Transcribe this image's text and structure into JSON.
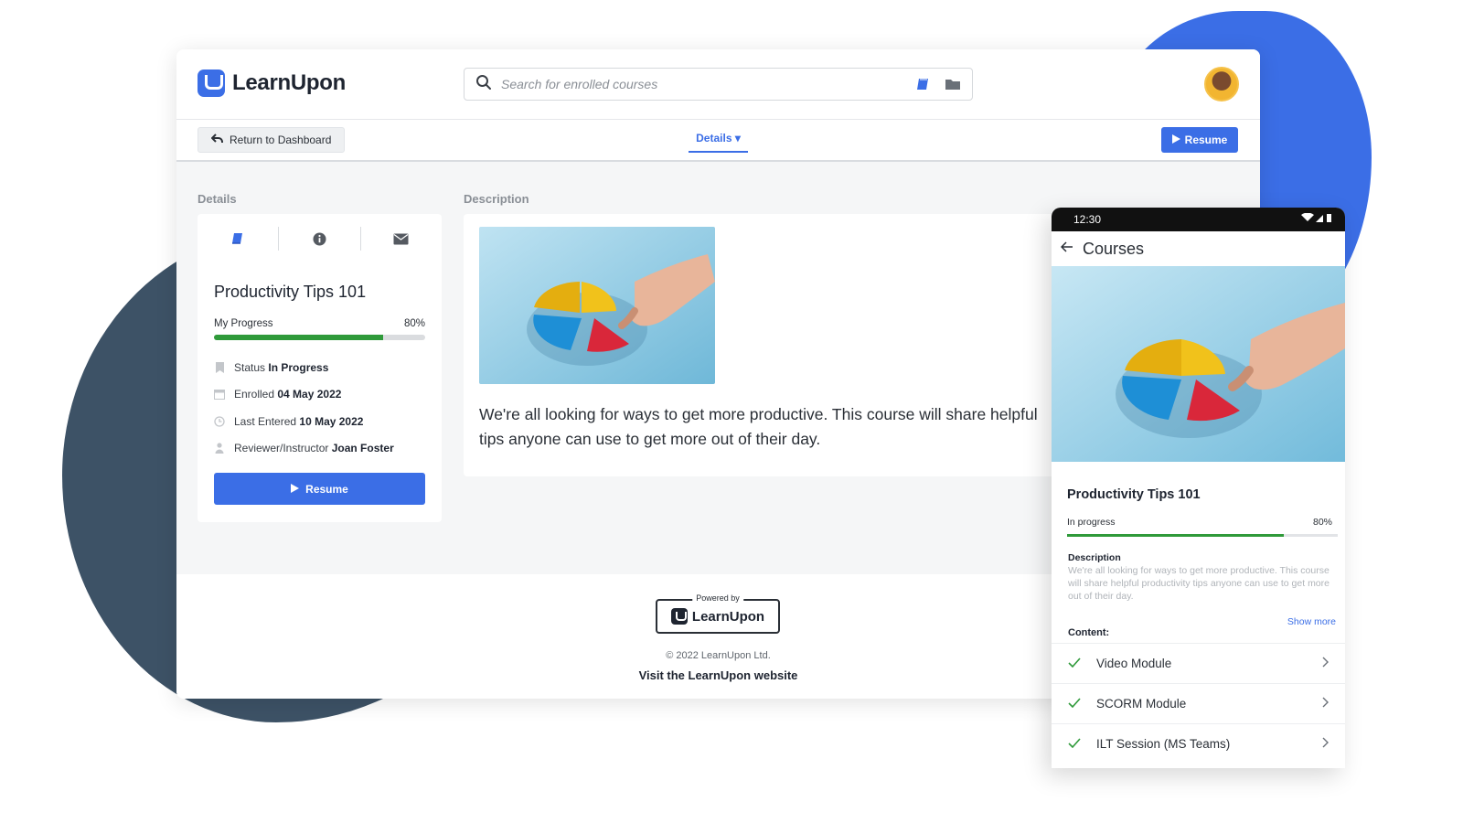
{
  "app": {
    "brand": "LearnUpon"
  },
  "header": {
    "search_placeholder": "Search for enrolled courses",
    "icons": [
      "search-icon",
      "book-icon",
      "folder-icon",
      "avatar"
    ]
  },
  "subbar": {
    "return_label": "Return to Dashboard",
    "details_tab": "Details ▾",
    "resume_label": "Resume"
  },
  "details": {
    "section_label": "Details",
    "tab_icons": [
      "book-icon",
      "info-icon",
      "envelope-icon"
    ],
    "course_title": "Productivity Tips 101",
    "progress_label": "My Progress",
    "progress_value": 0.8,
    "progress_text": "80%",
    "meta": [
      {
        "key": "Status",
        "value": "In Progress",
        "icon": "bookmark-icon"
      },
      {
        "key": "Enrolled",
        "value": "04 May 2022",
        "icon": "calendar-icon"
      },
      {
        "key": "Last Entered",
        "value": "10 May 2022",
        "icon": "clock-icon"
      },
      {
        "key": "Reviewer/Instructor",
        "value": "Joan Foster",
        "icon": "person-icon"
      }
    ],
    "resume_label": "Resume"
  },
  "description": {
    "section_label": "Description",
    "text": "We're all looking for ways to get more productive. This course will share helpful tips anyone can use to get more out of their day."
  },
  "footer": {
    "powered_by": "Powered by",
    "logo_text": "LearnUpon",
    "copyright": "© 2022 LearnUpon Ltd.",
    "link": "Visit the LearnUpon website"
  },
  "mobile": {
    "time": "12:30",
    "header_title": "Courses",
    "course_title": "Productivity Tips 101",
    "progress_label": "In progress",
    "progress_value": 0.8,
    "progress_text": "80%",
    "description_heading": "Description",
    "description_text": "We're all looking for ways to get more productive. This course will share helpful productivity tips anyone can use to get more out of their day.",
    "show_more": "Show more",
    "content_heading": "Content:",
    "content_items": [
      "Video Module",
      "SCORM Module",
      "ILT Session (MS Teams)"
    ]
  },
  "colors": {
    "accent": "#3b6ee6",
    "progress": "#2f9a3a",
    "blob_dark": "#3d5266",
    "text_dark": "#1e2430"
  }
}
